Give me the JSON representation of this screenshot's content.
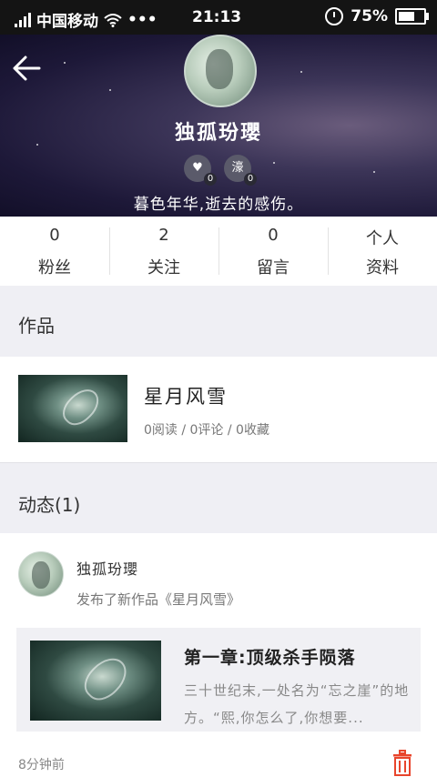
{
  "status_bar": {
    "carrier": "中国移动",
    "wifi_icon": "wifi-icon",
    "more": "•••",
    "time": "21:13",
    "alarm_icon": "alarm-icon",
    "battery_text": "75%",
    "battery_level": 0.75
  },
  "profile": {
    "back_icon": "back-arrow-icon",
    "name": "独孤玢瓔",
    "badge_like_count": "0",
    "badge_second_label": "濠",
    "badge_second_count": "0",
    "signature": "暮色年华,逝去的感伤。"
  },
  "stats": [
    {
      "value": "0",
      "label": "粉丝"
    },
    {
      "value": "2",
      "label": "关注"
    },
    {
      "value": "0",
      "label": "留言"
    },
    {
      "value": "个人",
      "label": "资料"
    }
  ],
  "works": {
    "header": "作品",
    "items": [
      {
        "title": "星月风雪",
        "stats": "0阅读 / 0评论 / 0收藏"
      }
    ]
  },
  "dynamics": {
    "header": "动态(1)",
    "post": {
      "name": "独孤玢瓔",
      "action": "发布了新作品《星月风雪》",
      "card_title": "第一章:顶级杀手陨落",
      "card_excerpt": "三十世纪末,一处名为“忘之崖”的地方。“熙,你怎么了,你想要...",
      "time": "8分钟前",
      "delete_icon": "trash-icon"
    }
  },
  "colors": {
    "status_bar_bg": "#141414",
    "section_bg": "#efeff4",
    "delete_icon": "#e8452c"
  }
}
